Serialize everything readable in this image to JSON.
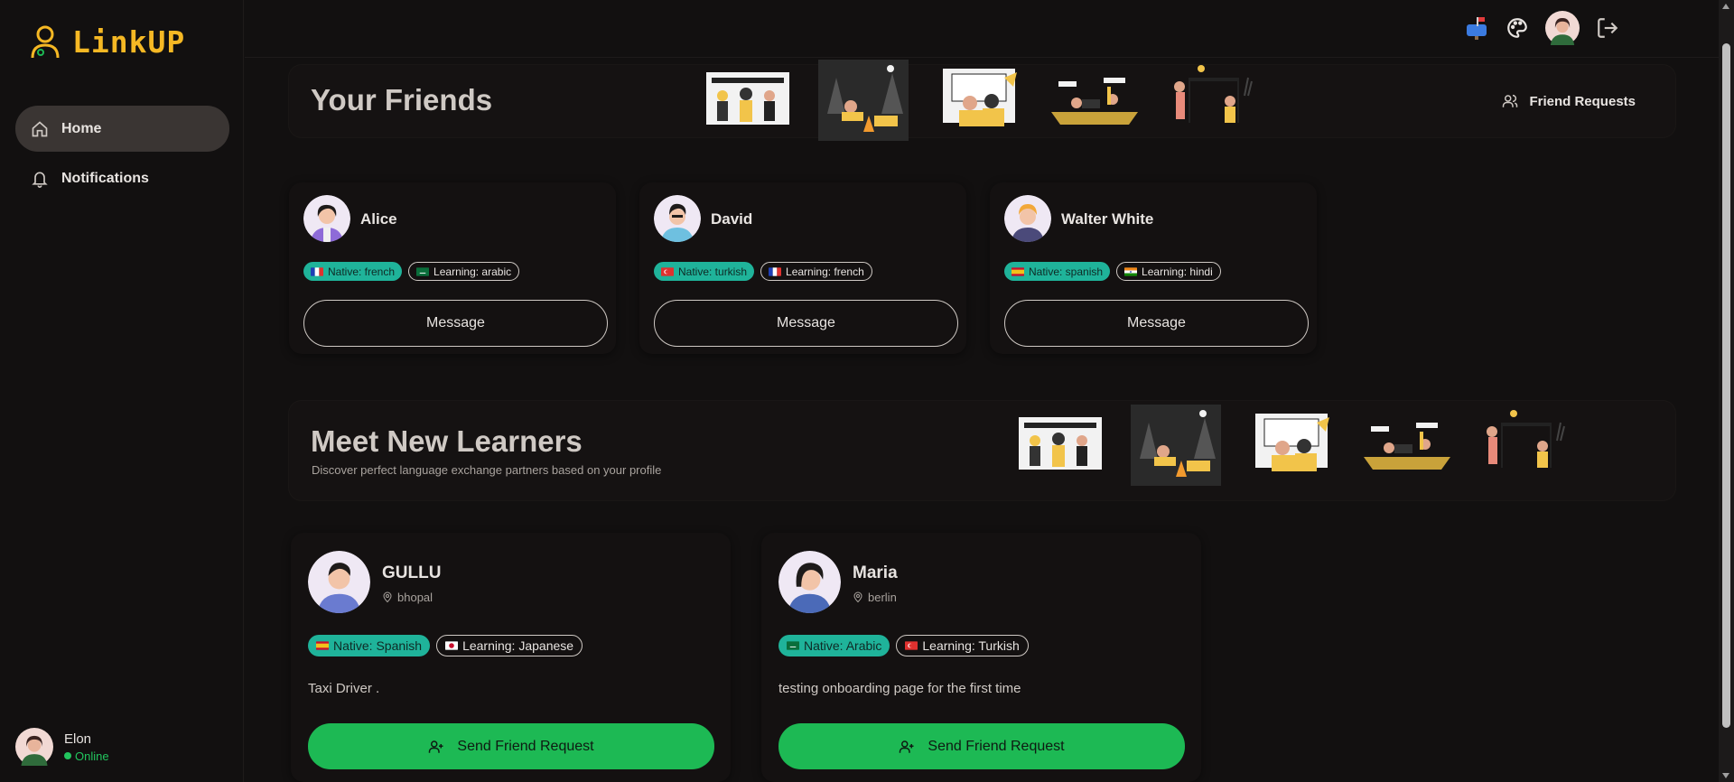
{
  "app": {
    "name": "LinkUP",
    "brand_color": "#f5b824",
    "accent_color": "#1db954",
    "native_color": "#1fb39a"
  },
  "sidebar": {
    "items": [
      {
        "label": "Home",
        "icon": "home-icon",
        "active": true
      },
      {
        "label": "Notifications",
        "icon": "bell-icon",
        "active": false
      }
    ],
    "user": {
      "name": "Elon",
      "status": "Online"
    }
  },
  "topbar": {
    "icons": [
      "mailbox-icon",
      "palette-icon",
      "avatar",
      "logout-icon"
    ]
  },
  "friends": {
    "title": "Your Friends",
    "requests_label": "Friend Requests",
    "cards": [
      {
        "name": "Alice",
        "native": "Native: french",
        "native_flag": "fr",
        "learning": "Learning: arabic",
        "learning_flag": "sa",
        "button": "Message"
      },
      {
        "name": "David",
        "native": "Native: turkish",
        "native_flag": "tr",
        "learning": "Learning: french",
        "learning_flag": "fr",
        "button": "Message"
      },
      {
        "name": "Walter White",
        "native": "Native: spanish",
        "native_flag": "es",
        "learning": "Learning: hindi",
        "learning_flag": "in",
        "button": "Message"
      }
    ]
  },
  "learners": {
    "title": "Meet New Learners",
    "subtitle": "Discover perfect language exchange partners based on your profile",
    "cards": [
      {
        "name": "GULLU",
        "location": "bhopal",
        "native": "Native: Spanish",
        "native_flag": "es",
        "learning": "Learning: Japanese",
        "learning_flag": "jp",
        "bio": "Taxi Driver .",
        "button": "Send Friend Request"
      },
      {
        "name": "Maria",
        "location": "berlin",
        "native": "Native: Arabic",
        "native_flag": "sa",
        "learning": "Learning: Turkish",
        "learning_flag": "tr",
        "bio": "testing onboarding page for the first time",
        "button": "Send Friend Request"
      }
    ]
  }
}
